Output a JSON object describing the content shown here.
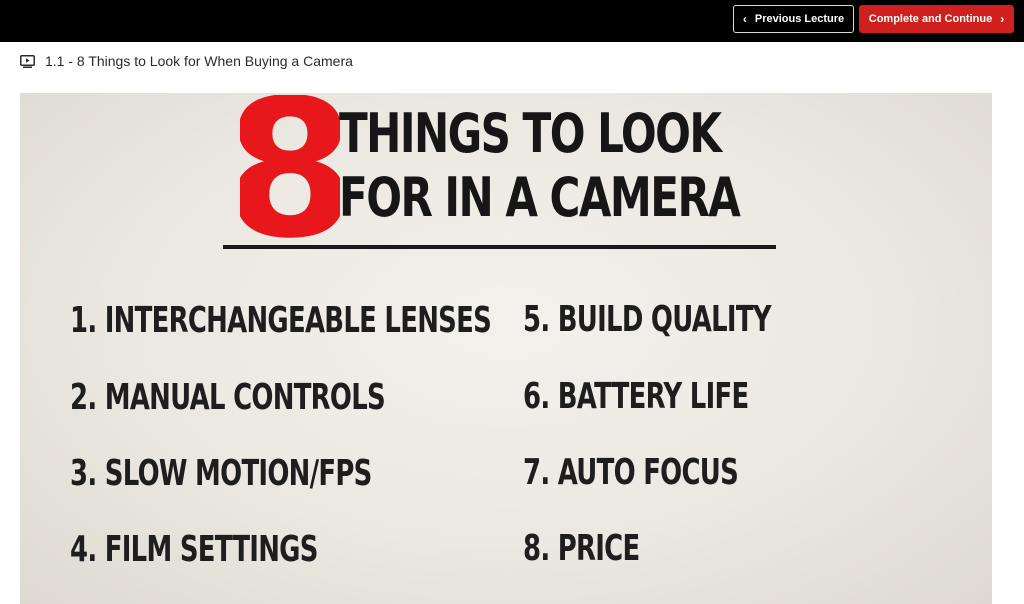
{
  "topbar": {
    "prev_label": "Previous Lecture",
    "next_label": "Complete and Continue"
  },
  "lecture": {
    "title": "1.1 - 8 Things to Look for When Buying a Camera"
  },
  "slide": {
    "big_number": "8",
    "headline_line1": "THINGS TO LOOK",
    "headline_line2": "FOR IN A CAMERA",
    "items": [
      "1. INTERCHANGEABLE LENSES",
      "2. MANUAL CONTROLS",
      "3. SLOW MOTION/FPS",
      "4. FILM SETTINGS",
      "5. BUILD QUALITY",
      "6. BATTERY LIFE",
      "7. AUTO FOCUS",
      "8. PRICE"
    ]
  },
  "colors": {
    "accent_red": "#d0201e",
    "eight_red": "#e8171c"
  },
  "icons": {
    "prev": "chevron-left-icon",
    "next": "chevron-right-icon",
    "lecture": "video-play-icon"
  }
}
